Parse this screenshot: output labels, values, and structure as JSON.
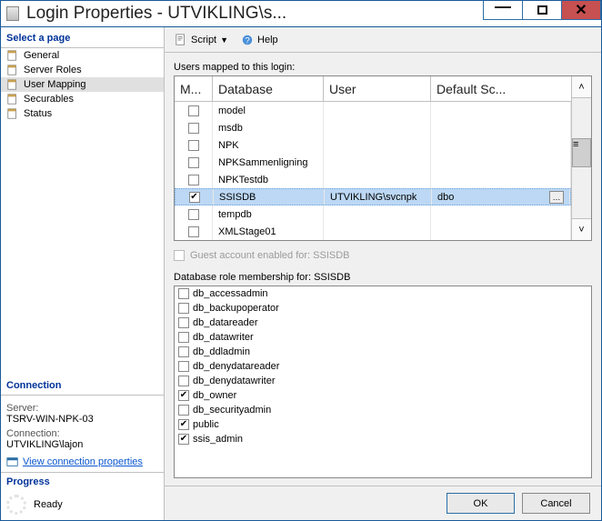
{
  "window": {
    "title": "Login Properties - UTVIKLING\\s..."
  },
  "toolbar": {
    "script": "Script",
    "help": "Help"
  },
  "sidebar": {
    "title": "Select a page",
    "items": [
      {
        "label": "General"
      },
      {
        "label": "Server Roles"
      },
      {
        "label": "User Mapping"
      },
      {
        "label": "Securables"
      },
      {
        "label": "Status"
      }
    ],
    "selected_index": 2
  },
  "connection": {
    "title": "Connection",
    "server_label": "Server:",
    "server": "TSRV-WIN-NPK-03",
    "conn_label": "Connection:",
    "conn": "UTVIKLING\\lajon",
    "link": "View connection properties"
  },
  "progress": {
    "title": "Progress",
    "status": "Ready"
  },
  "mapping": {
    "label": "Users mapped to this login:",
    "columns": {
      "map": "M...",
      "db": "Database",
      "user": "User",
      "schema": "Default Sc..."
    },
    "rows": [
      {
        "checked": false,
        "db": "model",
        "user": "",
        "schema": ""
      },
      {
        "checked": false,
        "db": "msdb",
        "user": "",
        "schema": ""
      },
      {
        "checked": false,
        "db": "NPK",
        "user": "",
        "schema": ""
      },
      {
        "checked": false,
        "db": "NPKSammenligning",
        "user": "",
        "schema": ""
      },
      {
        "checked": false,
        "db": "NPKTestdb",
        "user": "",
        "schema": ""
      },
      {
        "checked": true,
        "db": "SSISDB",
        "user": "UTVIKLING\\svcnpk",
        "schema": "dbo"
      },
      {
        "checked": false,
        "db": "tempdb",
        "user": "",
        "schema": ""
      },
      {
        "checked": false,
        "db": "XMLStage01",
        "user": "",
        "schema": ""
      }
    ],
    "selected_index": 5
  },
  "guest": {
    "label": "Guest account enabled for: SSISDB"
  },
  "roles": {
    "label": "Database role membership for: SSISDB",
    "items": [
      {
        "checked": false,
        "name": "db_accessadmin"
      },
      {
        "checked": false,
        "name": "db_backupoperator"
      },
      {
        "checked": false,
        "name": "db_datareader"
      },
      {
        "checked": false,
        "name": "db_datawriter"
      },
      {
        "checked": false,
        "name": "db_ddladmin"
      },
      {
        "checked": false,
        "name": "db_denydatareader"
      },
      {
        "checked": false,
        "name": "db_denydatawriter"
      },
      {
        "checked": true,
        "name": "db_owner"
      },
      {
        "checked": false,
        "name": "db_securityadmin"
      },
      {
        "checked": true,
        "name": "public"
      },
      {
        "checked": true,
        "name": "ssis_admin"
      }
    ]
  },
  "buttons": {
    "ok": "OK",
    "cancel": "Cancel"
  }
}
